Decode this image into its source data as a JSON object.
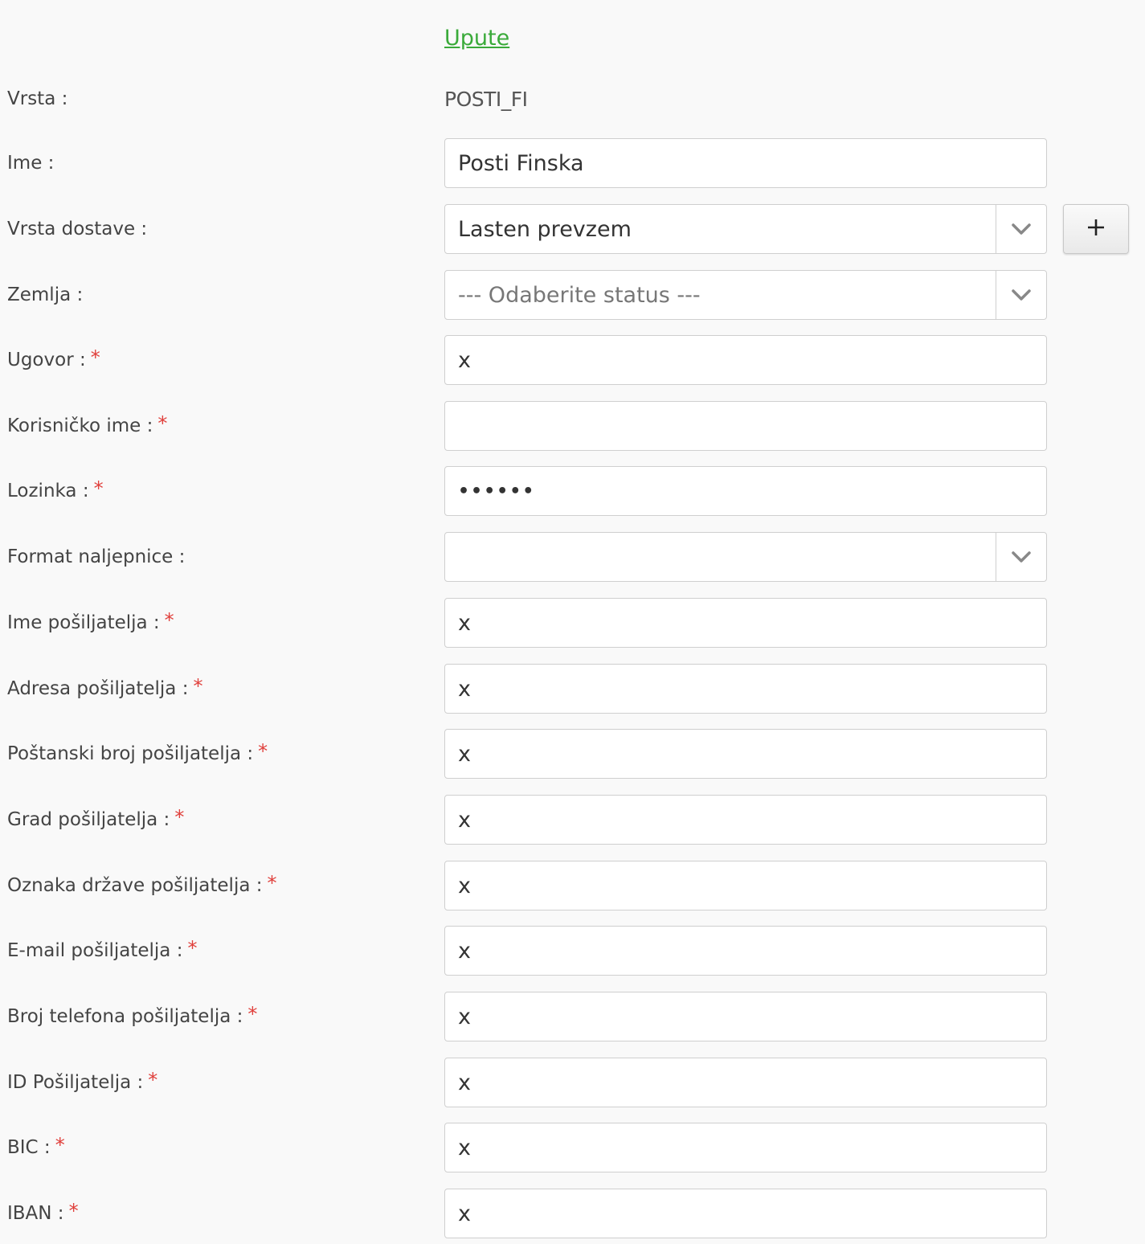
{
  "help_link": "Upute",
  "vrsta": {
    "label": "Vrsta :",
    "value": "POSTI_FI"
  },
  "ime": {
    "label": "Ime :",
    "value": "Posti Finska"
  },
  "vrsta_dostave": {
    "label": "Vrsta dostave :",
    "value": "Lasten prevzem",
    "add_label": "+"
  },
  "zemlja": {
    "label": "Zemlja :",
    "value": "--- Odaberite status ---"
  },
  "ugovor": {
    "label": "Ugovor :",
    "value": "x"
  },
  "korisnicko_ime": {
    "label": "Korisničko ime :",
    "value": ""
  },
  "lozinka": {
    "label": "Lozinka :",
    "value": "••••••"
  },
  "format_naljepnice": {
    "label": "Format naljepnice :",
    "value": ""
  },
  "ime_posiljatelja": {
    "label": "Ime pošiljatelja :",
    "value": "x"
  },
  "adresa_posiljatelja": {
    "label": "Adresa pošiljatelja :",
    "value": "x"
  },
  "postanski_broj_posiljatelja": {
    "label": "Poštanski broj pošiljatelja :",
    "value": "x"
  },
  "grad_posiljatelja": {
    "label": "Grad pošiljatelja :",
    "value": "x"
  },
  "oznaka_drzave_posiljatelja": {
    "label": "Oznaka države pošiljatelja :",
    "value": "x"
  },
  "email_posiljatelja": {
    "label": "E-mail pošiljatelja :",
    "value": "x"
  },
  "broj_telefona_posiljatelja": {
    "label": "Broj telefona pošiljatelja :",
    "value": "x"
  },
  "id_posiljatelja": {
    "label": "ID Pošiljatelja :",
    "value": "x"
  },
  "bic": {
    "label": "BIC :",
    "value": "x"
  },
  "iban": {
    "label": "IBAN :",
    "value": "x"
  },
  "required_marker": "*",
  "colors": {
    "link": "#3aaa3a",
    "required": "#e0403c",
    "border": "#cfcfcf",
    "background": "#f9f9f9"
  },
  "icons": {
    "select": "chevron-down-icon",
    "add": "plus-icon"
  }
}
